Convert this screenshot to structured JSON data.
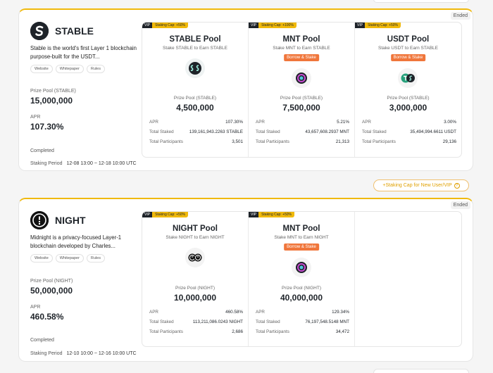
{
  "projects": [
    {
      "name": "STABLE",
      "status": "Ended",
      "description": "Stable is the world's first Layer 1 blockchain purpose-built for the USDT...",
      "links": [
        "Website",
        "Whitepaper",
        "Rules"
      ],
      "prize_pool_label": "Prize Pool (STABLE)",
      "prize_pool_value": "15,000,000",
      "apr_label": "APR",
      "apr_value": "107.30%",
      "state": "Completed",
      "period_label": "Staking Period",
      "period_value": "12-08 13:00 ~ 12-18 10:00 UTC",
      "pools": [
        {
          "vip": "VIP",
          "cap": "Staking Cap: +50%",
          "title": "STABLE Pool",
          "subtitle": "Stake STABLE to Earn STABLE",
          "borrow": "",
          "icon": "stable-token-icon",
          "prize_label": "Prize Pool (STABLE)",
          "prize_value": "4,500,000",
          "apr_label": "APR",
          "apr": "107.30%",
          "staked_label": "Total Staked",
          "staked": "139,161,943.2263 STABLE",
          "participants_label": "Total Participants",
          "participants": "3,501"
        },
        {
          "vip": "VIP",
          "cap": "Staking Cap: +100%",
          "title": "MNT Pool",
          "subtitle": "Stake MNT to Earn STABLE",
          "borrow": "Borrow & Stake",
          "icon": "mnt-token-icon",
          "prize_label": "Prize Pool (STABLE)",
          "prize_value": "7,500,000",
          "apr_label": "APR",
          "apr": "5.21%",
          "staked_label": "Total Staked",
          "staked": "43,657,608.2937 MNT",
          "participants_label": "Total Participants",
          "participants": "21,313"
        },
        {
          "vip": "VIP",
          "cap": "Staking Cap: +50%",
          "title": "USDT Pool",
          "subtitle": "Stake USDT to Earn STABLE",
          "borrow": "Borrow & Stake",
          "icon": "usdt-token-icon",
          "prize_label": "Prize Pool (STABLE)",
          "prize_value": "3,000,000",
          "apr_label": "APR",
          "apr": "3.00%",
          "staked_label": "Total Staked",
          "staked": "35,494,994.6611 USDT",
          "participants_label": "Total Participants",
          "participants": "29,136"
        }
      ]
    },
    {
      "name": "NIGHT",
      "status": "Ended",
      "description": "Midnight is a privacy-focused Layer-1 blockchain developed by Charles...",
      "links": [
        "Website",
        "Whitepaper",
        "Rules"
      ],
      "prize_pool_label": "Prize Pool (NIGHT)",
      "prize_pool_value": "50,000,000",
      "apr_label": "APR",
      "apr_value": "460.58%",
      "state": "Completed",
      "period_label": "Staking Period",
      "period_value": "12-10 10:00 ~ 12-16 10:00 UTC",
      "pools": [
        {
          "vip": "VIP",
          "cap": "Staking Cap: +50%",
          "title": "NIGHT Pool",
          "subtitle": "Stake NIGHT to Earn NIGHT",
          "borrow": "",
          "icon": "night-token-icon",
          "prize_label": "Prize Pool (NIGHT)",
          "prize_value": "10,000,000",
          "apr_label": "APR",
          "apr": "460.58%",
          "staked_label": "Total Staked",
          "staked": "113,211,086.0243 NIGHT",
          "participants_label": "Total Participants",
          "participants": "2,686"
        },
        {
          "vip": "VIP",
          "cap": "Staking Cap: +50%",
          "title": "MNT Pool",
          "subtitle": "Stake MNT to Earn NIGHT",
          "borrow": "Borrow & Stake",
          "icon": "mnt-token-icon",
          "prize_label": "Prize Pool (NIGHT)",
          "prize_value": "40,000,000",
          "apr_label": "APR",
          "apr": "129.34%",
          "staked_label": "Total Staked",
          "staked": "76,197,548.5148 MNT",
          "participants_label": "Total Participants",
          "participants": "34,472"
        }
      ]
    }
  ],
  "staking_cap_button": "+Staking Cap for New User/VIP",
  "colors": {
    "accent": "#f0b90b",
    "borrow": "#f0763b",
    "text": "#1e2329"
  }
}
